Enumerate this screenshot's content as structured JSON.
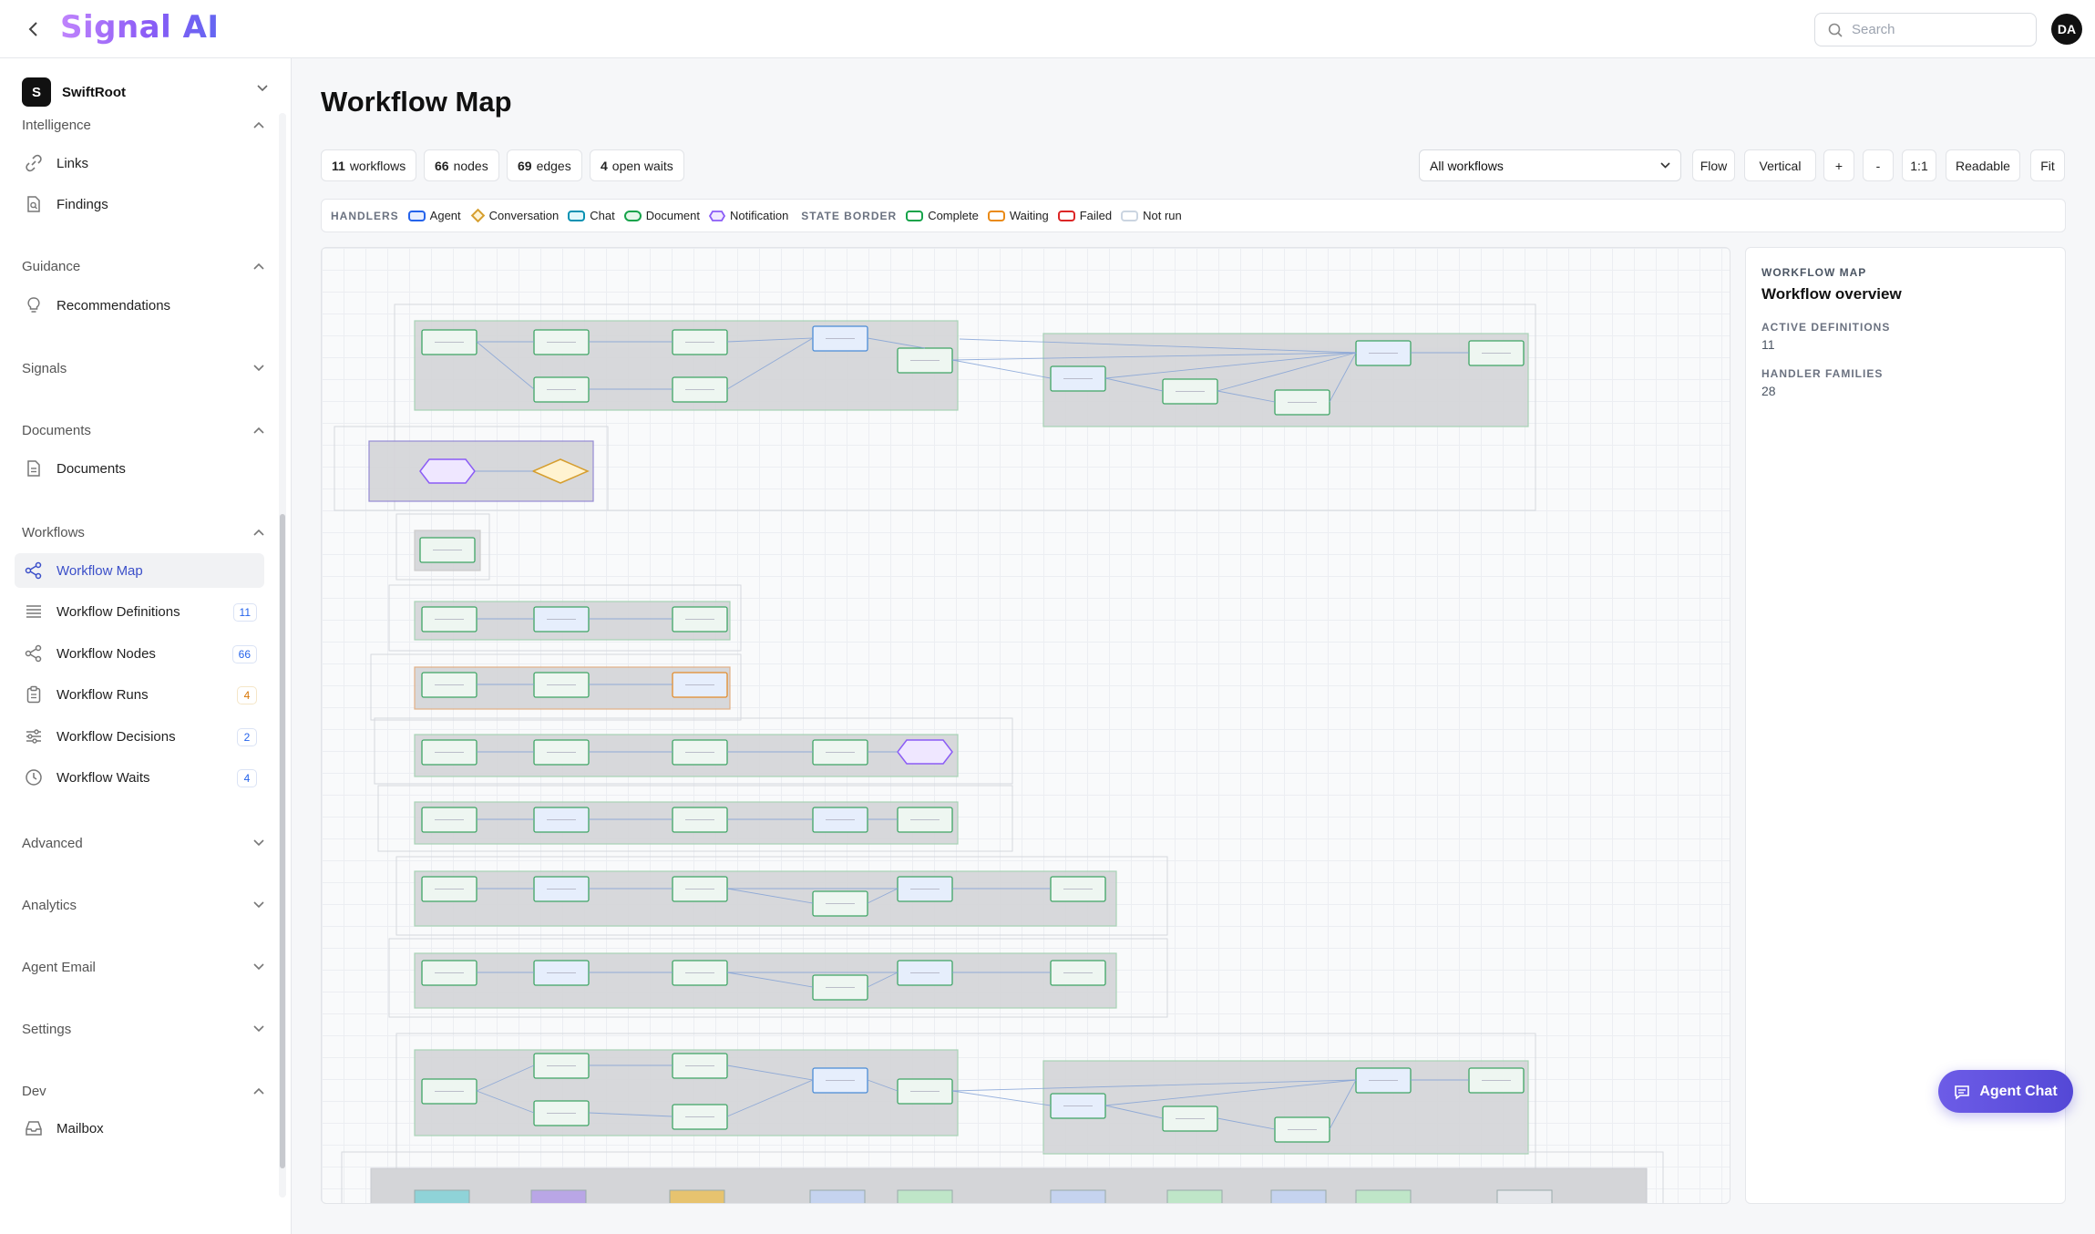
{
  "app": {
    "logo": "Signal AI",
    "avatar_initials": "DA",
    "search_placeholder": "Search"
  },
  "org": {
    "initial": "S",
    "name": "SwiftRoot"
  },
  "sidebar": {
    "sections": [
      {
        "label": "Intelligence",
        "expanded": true,
        "items": [
          {
            "label": "Links",
            "icon": "link-icon"
          },
          {
            "label": "Findings",
            "icon": "findings-icon"
          }
        ]
      },
      {
        "label": "Guidance",
        "expanded": true,
        "items": [
          {
            "label": "Recommendations",
            "icon": "lightbulb-icon"
          }
        ]
      },
      {
        "label": "Signals",
        "expanded": false,
        "items": []
      },
      {
        "label": "Documents",
        "expanded": true,
        "items": [
          {
            "label": "Documents",
            "icon": "document-icon"
          }
        ]
      },
      {
        "label": "Workflows",
        "expanded": true,
        "items": [
          {
            "label": "Workflow Map",
            "icon": "share-nodes-icon",
            "active": true
          },
          {
            "label": "Workflow Definitions",
            "icon": "list-icon",
            "badge": "11"
          },
          {
            "label": "Workflow Nodes",
            "icon": "share-nodes-icon",
            "badge": "66"
          },
          {
            "label": "Workflow Runs",
            "icon": "clipboard-icon",
            "badge": "4"
          },
          {
            "label": "Workflow Decisions",
            "icon": "sliders-icon",
            "badge": "2"
          },
          {
            "label": "Workflow Waits",
            "icon": "clock-icon",
            "badge": "4"
          }
        ]
      },
      {
        "label": "Advanced",
        "expanded": false,
        "items": []
      },
      {
        "label": "Analytics",
        "expanded": false,
        "items": []
      },
      {
        "label": "Agent Email",
        "expanded": false,
        "items": []
      },
      {
        "label": "Settings",
        "expanded": false,
        "items": []
      },
      {
        "label": "Dev",
        "expanded": true,
        "items": [
          {
            "label": "Mailbox",
            "icon": "inbox-icon"
          }
        ]
      }
    ]
  },
  "main": {
    "title": "Workflow Map",
    "stats": [
      {
        "value": "11",
        "label": "workflows"
      },
      {
        "value": "66",
        "label": "nodes"
      },
      {
        "value": "69",
        "label": "edges"
      },
      {
        "value": "4",
        "label": "open waits"
      }
    ],
    "filter": {
      "selected": "All workflows"
    },
    "toolbar": {
      "flow": "Flow",
      "vertical": "Vertical",
      "zoom_in": "+",
      "zoom_out": "-",
      "reset": "1:1",
      "readable": "Readable",
      "fit": "Fit"
    },
    "legend": {
      "handlers_caption": "HANDLERS",
      "handlers": [
        "Agent",
        "Conversation",
        "Chat",
        "Document",
        "Notification"
      ],
      "state_caption": "STATE BORDER",
      "states": [
        "Complete",
        "Waiting",
        "Failed",
        "Not run"
      ]
    }
  },
  "panel": {
    "kicker": "WORKFLOW MAP",
    "title": "Workflow overview",
    "active_definitions_label": "ACTIVE DEFINITIONS",
    "active_definitions": "11",
    "handler_families_label": "HANDLER FAMILIES",
    "handler_families": "28"
  },
  "agent_chat": {
    "label": "Agent Chat"
  },
  "colors": {
    "accent": "#3b4fc9",
    "agent": "#2563eb",
    "conversation": "#d69e2e",
    "chat": "#0891b2",
    "document": "#16a34a",
    "notification": "#8b5cf6",
    "complete": "#16a34a",
    "waiting": "#ea8a16",
    "failed": "#dc2626",
    "not_run": "#cbd5e1"
  }
}
